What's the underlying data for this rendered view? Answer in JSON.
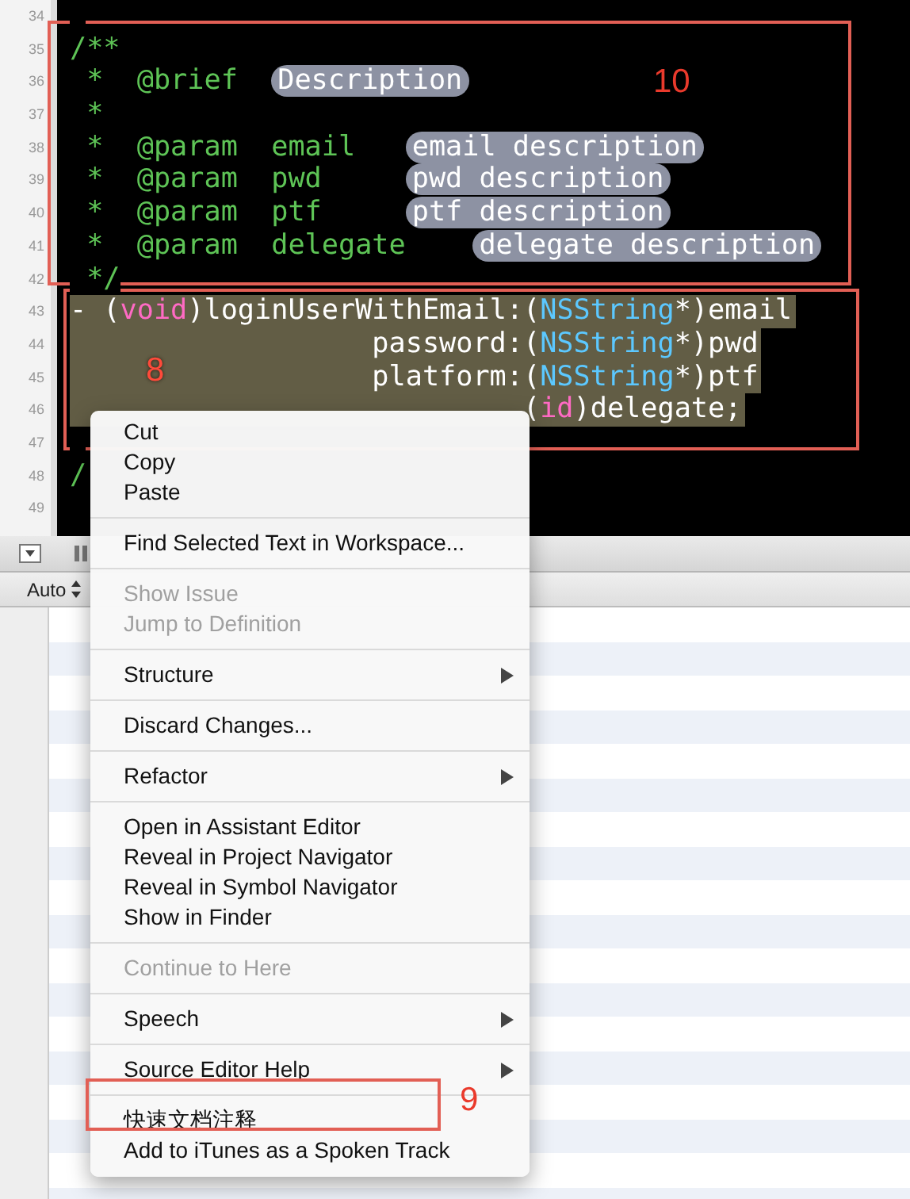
{
  "editor": {
    "lines": [
      {
        "number": "34"
      },
      {
        "number": "35",
        "selected": false,
        "tokens": [
          {
            "kind": "comment",
            "text": "/**"
          }
        ]
      },
      {
        "number": "36",
        "selected": false,
        "tokens": [
          {
            "kind": "comment",
            "text": " *  @brief  "
          },
          {
            "kind": "placeholder",
            "text": "Description"
          }
        ]
      },
      {
        "number": "37",
        "selected": false,
        "tokens": [
          {
            "kind": "comment",
            "text": " *"
          }
        ]
      },
      {
        "number": "38",
        "selected": false,
        "tokens": [
          {
            "kind": "comment",
            "text": " *  @param  email   "
          },
          {
            "kind": "placeholder",
            "text": "email description"
          }
        ]
      },
      {
        "number": "39",
        "selected": false,
        "tokens": [
          {
            "kind": "comment",
            "text": " *  @param  pwd     "
          },
          {
            "kind": "placeholder",
            "text": "pwd description"
          }
        ]
      },
      {
        "number": "40",
        "selected": false,
        "tokens": [
          {
            "kind": "comment",
            "text": " *  @param  ptf     "
          },
          {
            "kind": "placeholder",
            "text": "ptf description"
          }
        ]
      },
      {
        "number": "41",
        "selected": false,
        "tokens": [
          {
            "kind": "comment",
            "text": " *  @param  delegate    "
          },
          {
            "kind": "placeholder",
            "text": "delegate description"
          }
        ]
      },
      {
        "number": "42",
        "selected": false,
        "tokens": [
          {
            "kind": "comment",
            "text": " */"
          }
        ]
      },
      {
        "number": "43",
        "selected": true,
        "tokens": [
          {
            "kind": "plain",
            "text": "- ("
          },
          {
            "kind": "keyword",
            "text": "void"
          },
          {
            "kind": "plain",
            "text": ")loginUserWithEmail:("
          },
          {
            "kind": "type",
            "text": "NSString"
          },
          {
            "kind": "plain",
            "text": "*)email"
          }
        ]
      },
      {
        "number": "44",
        "selected": true,
        "tokens": [
          {
            "kind": "plain",
            "text": "                  password:("
          },
          {
            "kind": "type",
            "text": "NSString"
          },
          {
            "kind": "plain",
            "text": "*)pwd"
          }
        ]
      },
      {
        "number": "45",
        "selected": true,
        "tokens": [
          {
            "kind": "plain",
            "text": "                  platform:("
          },
          {
            "kind": "type",
            "text": "NSString"
          },
          {
            "kind": "plain",
            "text": "*)ptf"
          }
        ]
      },
      {
        "number": "46",
        "selected": true,
        "tokens": [
          {
            "kind": "plain",
            "text": "                           ("
          },
          {
            "kind": "keyword",
            "text": "id"
          },
          {
            "kind": "plain",
            "text": ")delegate;"
          }
        ]
      },
      {
        "number": "47"
      },
      {
        "number": "48",
        "selected": false,
        "tokens": [
          {
            "kind": "comment",
            "text": "/"
          }
        ]
      },
      {
        "number": "49"
      }
    ]
  },
  "debug_bar": {
    "scope_selector": "Auto"
  },
  "context_menu": {
    "sections": [
      [
        {
          "label": "Cut",
          "disabled": false,
          "submenu": false
        },
        {
          "label": "Copy",
          "disabled": false,
          "submenu": false
        },
        {
          "label": "Paste",
          "disabled": false,
          "submenu": false
        }
      ],
      [
        {
          "label": "Find Selected Text in Workspace...",
          "disabled": false,
          "submenu": false
        }
      ],
      [
        {
          "label": "Show Issue",
          "disabled": true,
          "submenu": false
        },
        {
          "label": "Jump to Definition",
          "disabled": true,
          "submenu": false
        }
      ],
      [
        {
          "label": "Structure",
          "disabled": false,
          "submenu": true
        }
      ],
      [
        {
          "label": "Discard Changes...",
          "disabled": false,
          "submenu": false
        }
      ],
      [
        {
          "label": "Refactor",
          "disabled": false,
          "submenu": true
        }
      ],
      [
        {
          "label": "Open in Assistant Editor",
          "disabled": false,
          "submenu": false
        },
        {
          "label": "Reveal in Project Navigator",
          "disabled": false,
          "submenu": false
        },
        {
          "label": "Reveal in Symbol Navigator",
          "disabled": false,
          "submenu": false
        },
        {
          "label": "Show in Finder",
          "disabled": false,
          "submenu": false
        }
      ],
      [
        {
          "label": "Continue to Here",
          "disabled": true,
          "submenu": false
        }
      ],
      [
        {
          "label": "Speech",
          "disabled": false,
          "submenu": true
        }
      ],
      [
        {
          "label": "Source Editor Help",
          "disabled": false,
          "submenu": true
        }
      ],
      [
        {
          "label": "快速文档注释",
          "disabled": false,
          "submenu": false
        },
        {
          "label": "Add to iTunes as a Spoken Track",
          "disabled": false,
          "submenu": false
        }
      ]
    ]
  },
  "annotations": [
    {
      "label": "10"
    },
    {
      "label": "8"
    },
    {
      "label": "9"
    }
  ]
}
